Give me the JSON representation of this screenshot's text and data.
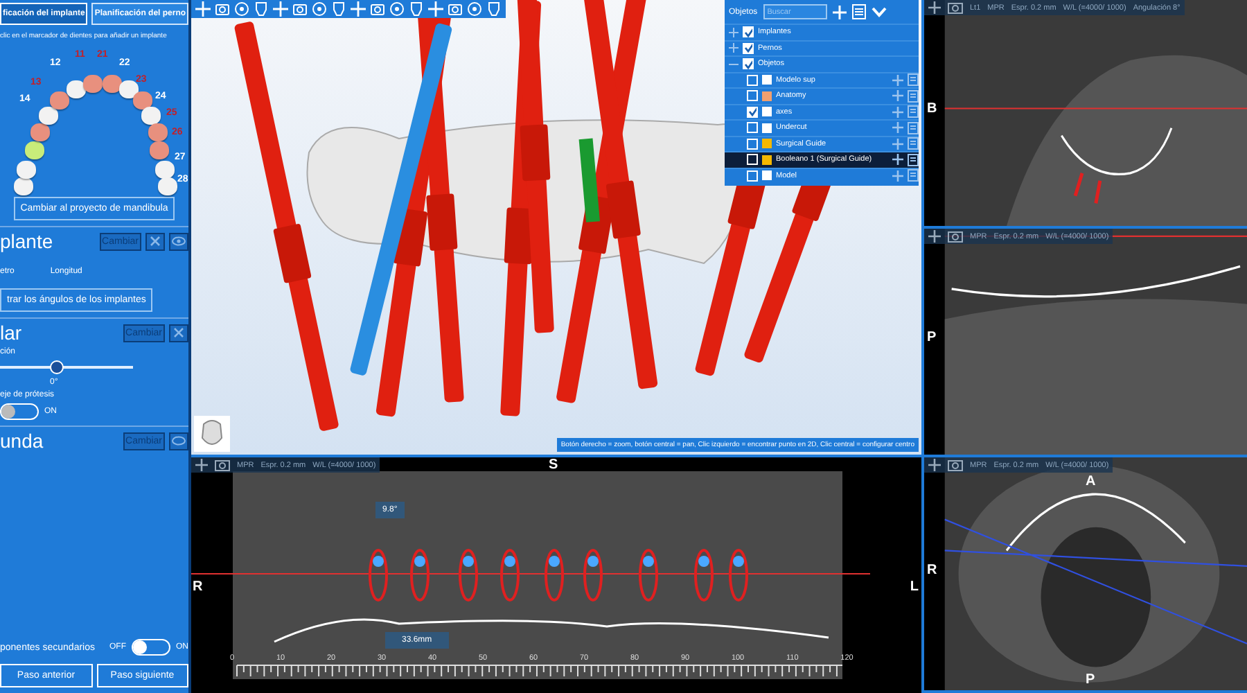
{
  "left_panel": {
    "tabs": [
      {
        "label": "ficación del implante",
        "selected": true
      },
      {
        "label": "Planificación del perno",
        "selected": false
      }
    ],
    "hint": "clic en el marcador de dientes para añadir un implante",
    "teeth": [
      {
        "kind": "empty"
      },
      {
        "kind": "empty"
      },
      {
        "kind": "selected"
      },
      {
        "kind": "planned"
      },
      {
        "number": "14",
        "kind": "empty"
      },
      {
        "number": "13",
        "kind": "planned"
      },
      {
        "number": "12",
        "kind": "empty"
      },
      {
        "number": "11",
        "kind": "planned"
      },
      {
        "number": "21",
        "kind": "planned"
      },
      {
        "number": "22",
        "kind": "empty"
      },
      {
        "number": "23",
        "kind": "planned"
      },
      {
        "number": "24",
        "kind": "empty"
      },
      {
        "number": "25",
        "kind": "planned"
      },
      {
        "number": "26",
        "kind": "planned"
      },
      {
        "number": "27",
        "kind": "empty"
      },
      {
        "number": "28",
        "kind": "empty"
      }
    ],
    "switch_button": "Cambiar al proyecto de mandibula",
    "implant": {
      "title": "plante",
      "change": "Cambiar",
      "col_1": "etro",
      "col_2": "Longitud",
      "show_angles": "trar los ángulos de los implantes"
    },
    "pillar": {
      "title": "lar",
      "change": "Cambiar",
      "slider_label": "ción",
      "level": 0.42,
      "reading": "0°",
      "axis_label": "eje de prótesis",
      "toggle": {
        "on": false,
        "label": "ON"
      }
    },
    "second": {
      "title": "unda",
      "change": "Cambiar"
    },
    "secondary": {
      "label": "ponentes secundarios",
      "off_label": "OFF",
      "on_label": "ON",
      "on": false
    },
    "nav": [
      "Paso anterior",
      "Paso siguiente"
    ]
  },
  "view_3d": {
    "status": "Botón derecho = zoom, botón central = pan, Clic izquierdo = encontrar punto en 2D, Clic central = configurar centro",
    "objects": {
      "title": "Objetos",
      "placeholder": "Buscar",
      "groups": [
        {
          "label": "Implantes",
          "checked": true,
          "expanded": false
        },
        {
          "label": "Pernos",
          "checked": true,
          "expanded": false
        },
        {
          "label": "Objetos",
          "checked": true,
          "expanded": true,
          "children": [
            {
              "label": "Modelo sup",
              "checked": false,
              "color": "#ffffff",
              "selected": false
            },
            {
              "label": "Anatomy",
              "checked": false,
              "color": "#f0a070",
              "selected": false
            },
            {
              "label": "axes",
              "checked": true,
              "color": "#ffffff",
              "selected": false
            },
            {
              "label": "Undercut",
              "checked": false,
              "color": "#ffffff",
              "selected": false
            },
            {
              "label": "Surgical Guide",
              "checked": false,
              "color": "#f5b800",
              "selected": false
            },
            {
              "label": "Booleano 1 (Surgical Guide)",
              "checked": false,
              "color": "#f5b800",
              "selected": true
            },
            {
              "label": "Model",
              "checked": false,
              "color": "#ffffff",
              "selected": false
            }
          ]
        }
      ]
    }
  },
  "views": [
    {
      "info": [
        "Lt1",
        "MPR",
        "Espr. 0.2 mm",
        "W/L (=4000/ 1000)",
        "Angulación 8°"
      ],
      "letters": [
        "B"
      ]
    },
    {
      "info": [
        "MPR",
        "Espr. 0.2 mm",
        "W/L (=4000/ 1000)"
      ],
      "letters": [
        "P"
      ]
    },
    {
      "info": [
        "MPR",
        "Espr. 0.2 mm",
        "W/L (=4000/ 1000)"
      ],
      "letters": [
        "A",
        "R",
        "P"
      ]
    }
  ],
  "panoramic": {
    "info": [
      "MPR",
      "Espr. 0.2 mm",
      "W/L (=4000/ 1000)"
    ],
    "top": "S",
    "left": "R",
    "right": "L",
    "angle": "9.8°",
    "distance": "33.6mm",
    "ruler": [
      "0",
      "10",
      "20",
      "30",
      "40",
      "50",
      "60",
      "70",
      "80",
      "90",
      "100",
      "110",
      "120"
    ]
  }
}
